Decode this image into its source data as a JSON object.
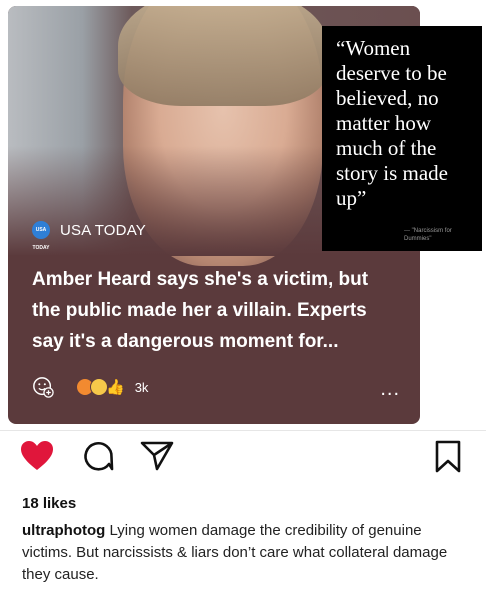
{
  "post": {
    "source_name": "USA TODAY",
    "source_logo_text": "USA TODAY",
    "headline": "Amber Heard says she's a victim, but the public made her a villain. Experts say it's a dangerous moment for...",
    "reaction_count": "3k",
    "more_label": "...",
    "quote": "“Women deserve to be believed, no matter how much of the story is made up”",
    "quote_attribution": "--- \"Narcissism for Dummies\""
  },
  "feed": {
    "likes": "18 likes",
    "caption_user": "ultraphotog",
    "caption_text": " Lying women damage the credibility of genuine victims. But narcissists & liars don’t care what collateral damage they cause."
  },
  "colors": {
    "card_bg": "#5b3a3c",
    "heart": "#e0163b",
    "quote_bg": "#000000"
  },
  "icons": [
    "add-reaction-icon",
    "angry-emoji-icon",
    "thinking-emoji-icon",
    "thumbs-up-icon",
    "heart-icon",
    "comment-icon",
    "share-icon",
    "bookmark-icon",
    "more-icon"
  ]
}
